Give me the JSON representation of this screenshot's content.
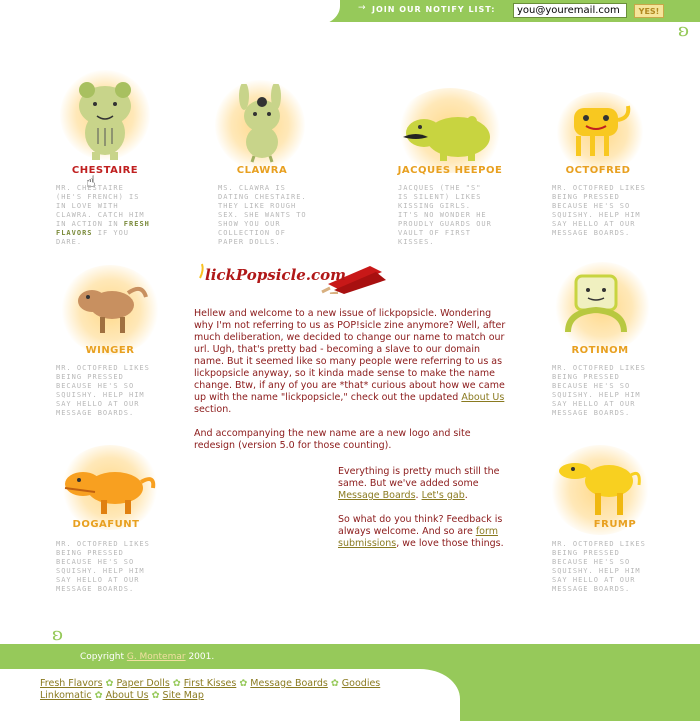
{
  "notify": {
    "label": "JOIN OUR NOTIFY LIST:",
    "email_value": "you@youremail.com",
    "submit_label": "YES!"
  },
  "logo": {
    "text": "lickPopsicle.com"
  },
  "characters": [
    {
      "name": "CHESTAIRE",
      "color": "#c02020",
      "desc_pre": "MR. CHESTAIRE (HE'S FRENCH) IS IN LOVE WITH CLAWRA. CATCH HIM IN ACTION IN ",
      "desc_link": "FRESH FLAVORS",
      "desc_post": " IF YOU DARE."
    },
    {
      "name": "CLAWRA",
      "color": "#e8a020",
      "desc": "MS. CLAWRA IS DATING CHESTAIRE. THEY LIKE ROUGH SEX. SHE WANTS TO SHOW YOU OUR COLLECTION OF PAPER DOLLS."
    },
    {
      "name": "JACQUES HEEPOE",
      "color": "#e8a020",
      "desc": "JACQUES (THE \"S\" IS SILENT) LIKES KISSING GIRLS. IT'S NO WONDER HE PROUDLY GUARDS OUR VAULT OF FIRST KISSES."
    },
    {
      "name": "OCTOFRED",
      "color": "#e8a020",
      "desc": "MR. OCTOFRED LIKES BEING PRESSED BECAUSE HE'S SO SQUISHY. HELP HIM SAY HELLO AT OUR MESSAGE BOARDS."
    },
    {
      "name": "WINGER",
      "color": "#e8a020",
      "desc": "MR. OCTOFRED LIKES BEING PRESSED BECAUSE HE'S SO SQUISHY. HELP HIM SAY HELLO AT OUR MESSAGE BOARDS."
    },
    {
      "name": "ROTINOM",
      "color": "#e8a020",
      "desc": "MR. OCTOFRED LIKES BEING PRESSED BECAUSE HE'S SO SQUISHY. HELP HIM SAY HELLO AT OUR MESSAGE BOARDS."
    },
    {
      "name": "DOGAFUNT",
      "color": "#e8a020",
      "desc": "MR. OCTOFRED LIKES BEING PRESSED BECAUSE HE'S SO SQUISHY. HELP HIM SAY HELLO AT OUR MESSAGE BOARDS."
    },
    {
      "name": "FRUMP",
      "color": "#e8a020",
      "desc": "MR. OCTOFRED LIKES BEING PRESSED BECAUSE HE'S SO SQUISHY. HELP HIM SAY HELLO AT OUR MESSAGE BOARDS."
    }
  ],
  "intro": {
    "p1_pre": "Hellew and welcome to a new issue of lickpopsicle. Wondering why I'm not referring to us as POP!sicle zine anymore? Well, after much deliberation, we decided to change our name to match our url. Ugh, that's pretty bad - becoming a slave to our domain name. But it seemed like so many people were referring to us as lickpopsicle anyway, so it kinda made sense to make the name change. Btw, if any of you are *that* curious about how we came up with the name \"lickpopsicle,\" check out the updated ",
    "p1_link": "About Us",
    "p1_post": " section.",
    "p2": "And accompanying the new name are a new logo and site redesign (version 5.0 for those counting).",
    "p3_pre": "Everything is pretty much still the same. But we've added some ",
    "p3_link1": "Message Boards",
    "p3_link2": "Let's gab",
    "p4_pre": "So what do you think? Feedback is always welcome. And so are ",
    "p4_link": "form submissions",
    "p4_post": ", we love those things."
  },
  "footer": {
    "copyright_pre": "Copyright ",
    "copyright_link": "G. Montemar",
    "copyright_post": " 2001.",
    "links_row1": [
      "Fresh Flavors",
      "Paper Dolls",
      "First Kisses",
      "Message Boards",
      "Goodies"
    ],
    "links_row2": [
      "Linkomatic",
      "About Us",
      "Site Map"
    ]
  },
  "colors": {
    "green": "#96c95a",
    "text_red": "#8b1a1a",
    "link_olive": "#8a7a20"
  }
}
